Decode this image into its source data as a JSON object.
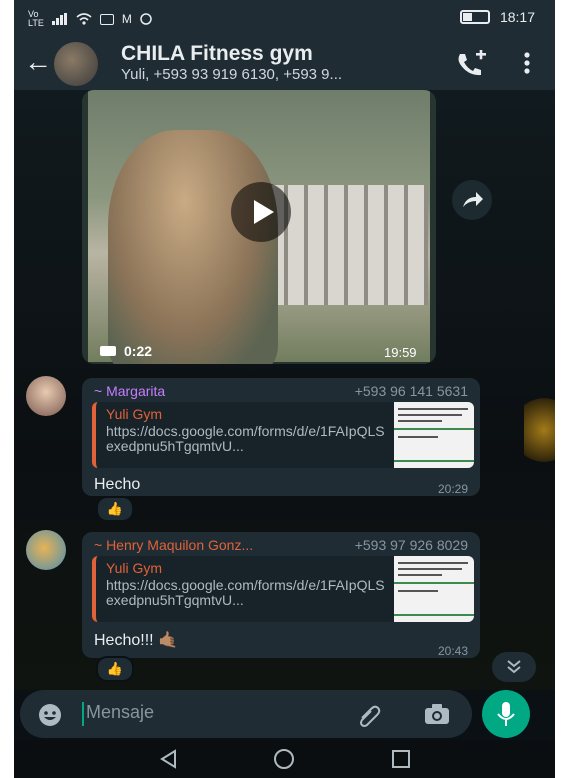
{
  "status_bar": {
    "left_icons": [
      "volte-icon",
      "signal-icon",
      "wifi-icon",
      "instagram-icon",
      "gmail-icon",
      "whatsapp-icon"
    ],
    "time": "18:17"
  },
  "header": {
    "title": "CHILA Fitness gym",
    "subtitle": "Yuli, +593 93 919 6130, +593 9..."
  },
  "video": {
    "duration": "0:22",
    "time": "19:59"
  },
  "messages": [
    {
      "sender": "~ Margarita",
      "sender_color": "#c77dff",
      "phone": "+593 96 141 5631",
      "quote_title": "Yuli Gym",
      "quote_text": "https://docs.google.com/forms/d/e/1FAIpQLSexedpnu5hTgqmtvU...",
      "text": "Hecho",
      "time": "20:29",
      "reaction": "👍"
    },
    {
      "sender": "~ Henry Maquilon Gonz...",
      "sender_color": "#e0623a",
      "phone": "+593 97 926 8029",
      "quote_title": "Yuli Gym",
      "quote_text": "https://docs.google.com/forms/d/e/1FAIpQLSexedpnu5hTgqmtvU...",
      "text": "Hecho!!! 🤙🏽",
      "time": "20:43",
      "reaction": "👍"
    }
  ],
  "composer": {
    "placeholder": "Mensaje"
  },
  "colors": {
    "accent": "#00a884",
    "bubble": "#1f2c34",
    "appbar": "#1f2c33"
  }
}
